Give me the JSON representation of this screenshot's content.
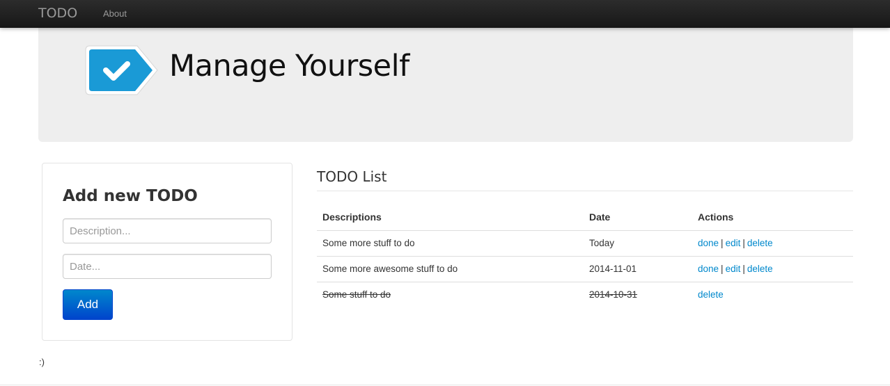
{
  "navbar": {
    "brand": "TODO",
    "links": [
      {
        "label": "About"
      }
    ]
  },
  "hero": {
    "title": "Manage Yourself",
    "logo_icon": "checkmark-badge-icon",
    "logo_color": "#1a9ad6"
  },
  "add_form": {
    "heading": "Add new TODO",
    "description_placeholder": "Description...",
    "description_value": "",
    "date_placeholder": "Date...",
    "date_value": "",
    "submit_label": "Add"
  },
  "todo_list": {
    "title": "TODO List",
    "columns": [
      "Descriptions",
      "Date",
      "Actions"
    ],
    "rows": [
      {
        "description": "Some more stuff to do",
        "date": "Today",
        "done": false,
        "actions": [
          "done",
          "edit",
          "delete"
        ]
      },
      {
        "description": "Some more awesome stuff to do",
        "date": "2014-11-01",
        "done": false,
        "actions": [
          "done",
          "edit",
          "delete"
        ]
      },
      {
        "description": "Some stuff to do",
        "date": "2014-10-31",
        "done": true,
        "actions": [
          "delete"
        ]
      }
    ],
    "separator": "|"
  },
  "footer": {
    "text": ":)"
  },
  "colors": {
    "link": "#0088cc",
    "button": "#0055cc",
    "navbar": "#1b1b1b",
    "hero_bg": "#eeeeee"
  }
}
